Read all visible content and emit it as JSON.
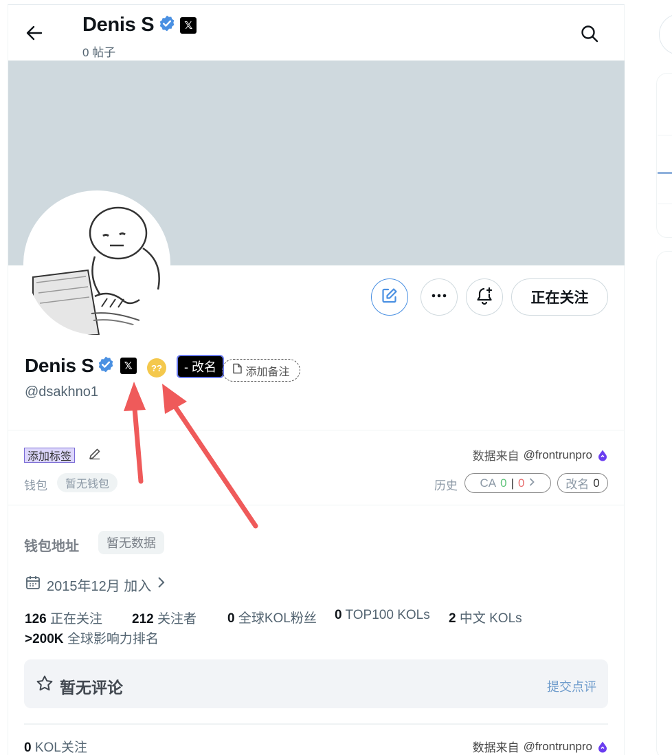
{
  "header": {
    "name": "Denis S",
    "posts": "0 帖子"
  },
  "profile": {
    "name": "Denis S",
    "handle": "@dsakhno1",
    "rename_label": "- 改名",
    "note_label": "添加备注",
    "follow_button": "正在关注",
    "coin_glyph": "??"
  },
  "tags": {
    "add_tag": "添加标签",
    "source_label": "数据来自",
    "source_handle": "@frontrunpro",
    "wallet_label": "钱包",
    "wallet_value": "暂无钱包",
    "history_label": "历史",
    "ca_label": "CA",
    "ca_green": "0",
    "ca_sep": "|",
    "ca_red": "0",
    "rename_label": "改名",
    "rename_count": "0"
  },
  "wallet_address": {
    "label": "钱包地址",
    "value": "暂无数据"
  },
  "joined": "2015年12月 加入",
  "stats": {
    "following_count": "126",
    "following_label": "正在关注",
    "followers_count": "212",
    "followers_label": "关注者",
    "kol_fans_count": "0",
    "kol_fans_label": "全球KOL粉丝",
    "top100_count": "0",
    "top100_label": "TOP100 KOLs",
    "cn_kol_count": "2",
    "cn_kol_label": "中文 KOLs",
    "rank_value": ">200K",
    "rank_label": "全球影响力排名"
  },
  "review": {
    "title": "暂无评论",
    "submit": "提交点评"
  },
  "kol_follow": {
    "count": "0",
    "label": "KOL关注",
    "source_label": "数据来自",
    "source_handle": "@frontrunpro"
  },
  "colors": {
    "verified": "#4a90e2",
    "banner": "#cfd9de",
    "accent_edit": "#4a90e2",
    "annotation_arrow": "#ef5a5a",
    "source_drop": "#6a3df0"
  }
}
